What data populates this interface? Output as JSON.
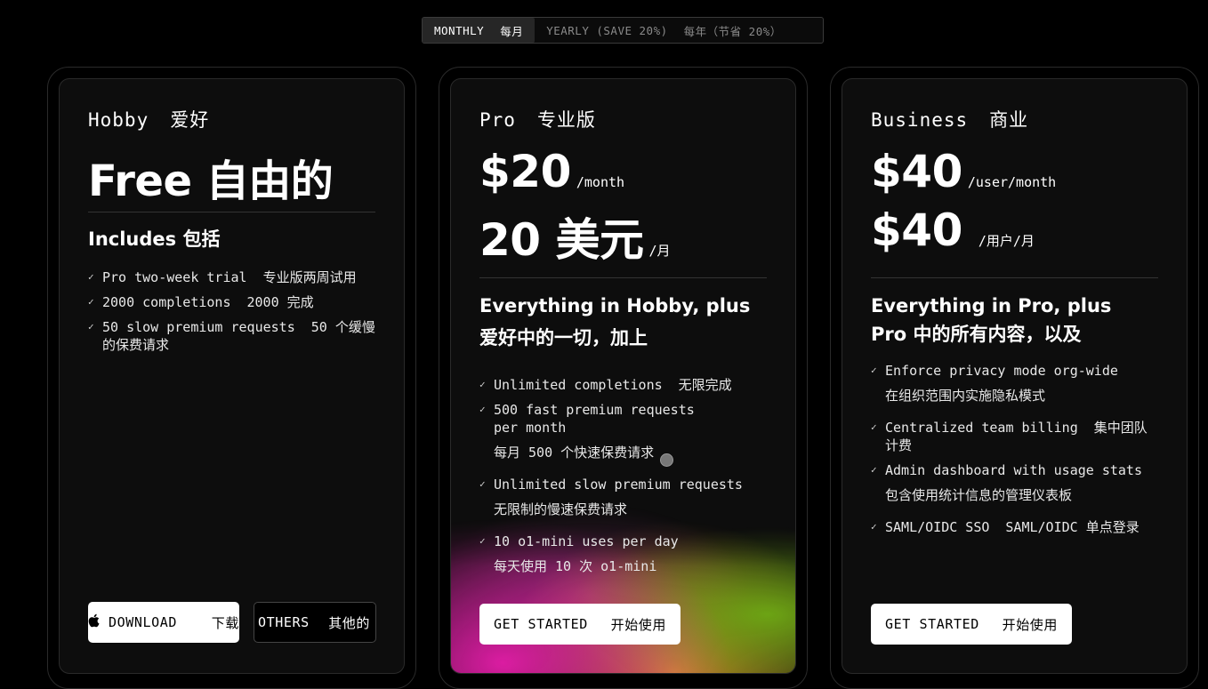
{
  "billing_toggle": {
    "monthly_en": "MONTHLY",
    "monthly_zh": "每月",
    "yearly_en": "YEARLY (SAVE 20%)",
    "yearly_zh": "每年（节省 20%）"
  },
  "plans": {
    "hobby": {
      "name_en": "Hobby",
      "name_zh": "爱好",
      "price": "Free 自由的",
      "includes_label": "Includes 包括",
      "features": [
        {
          "en": "Pro two-week trial",
          "zh": "专业版两周试用"
        },
        {
          "en": "2000 completions",
          "zh": "2000 完成"
        },
        {
          "en": "50 slow premium requests",
          "zh": "50 个缓慢的保费请求"
        }
      ],
      "button_download_en": "DOWNLOAD",
      "button_download_zh": "下载",
      "button_others_en": "OTHERS",
      "button_others_zh": "其他的"
    },
    "pro": {
      "name_en": "Pro",
      "name_zh": "专业版",
      "price_en": "$20",
      "unit_en": "/month",
      "price_zh": "20 美元",
      "unit_zh": "/月",
      "includes_en": "Everything in Hobby, plus",
      "includes_zh": "爱好中的一切，加上",
      "features": [
        {
          "en": "Unlimited completions",
          "zh": "无限完成"
        },
        {
          "en": "500 fast premium requests per month",
          "zh": "每月 500 个快速保费请求"
        },
        {
          "en": "Unlimited slow premium requests",
          "zh": "无限制的慢速保费请求"
        },
        {
          "en": "10 o1-mini uses per day",
          "zh": "每天使用 10 次 o1-mini"
        }
      ],
      "button_en": "GET STARTED",
      "button_zh": "开始使用"
    },
    "business": {
      "name_en": "Business",
      "name_zh": "商业",
      "price_en": "$40",
      "unit_en": "/user/month",
      "price_zh": "$40",
      "unit_zh": "/用户/月",
      "includes": "Everything in Pro, plus Pro 中的所有内容，以及",
      "features": [
        {
          "en": "Enforce privacy mode org-wide",
          "zh": "在组织范围内实施隐私模式"
        },
        {
          "en": "Centralized team billing",
          "zh": "集中团队计费"
        },
        {
          "en": "Admin dashboard with usage stats",
          "zh": "包含使用统计信息的管理仪表板"
        },
        {
          "en": "SAML/OIDC SSO",
          "zh": "SAML/OIDC 单点登录"
        }
      ],
      "button_en": "GET STARTED",
      "button_zh": "开始使用"
    }
  },
  "colors": {
    "background": "#000000",
    "card": "#0d0d0d",
    "button_white": "#ffffff"
  },
  "icons": {
    "check": "check-icon",
    "apple": "apple-icon"
  }
}
